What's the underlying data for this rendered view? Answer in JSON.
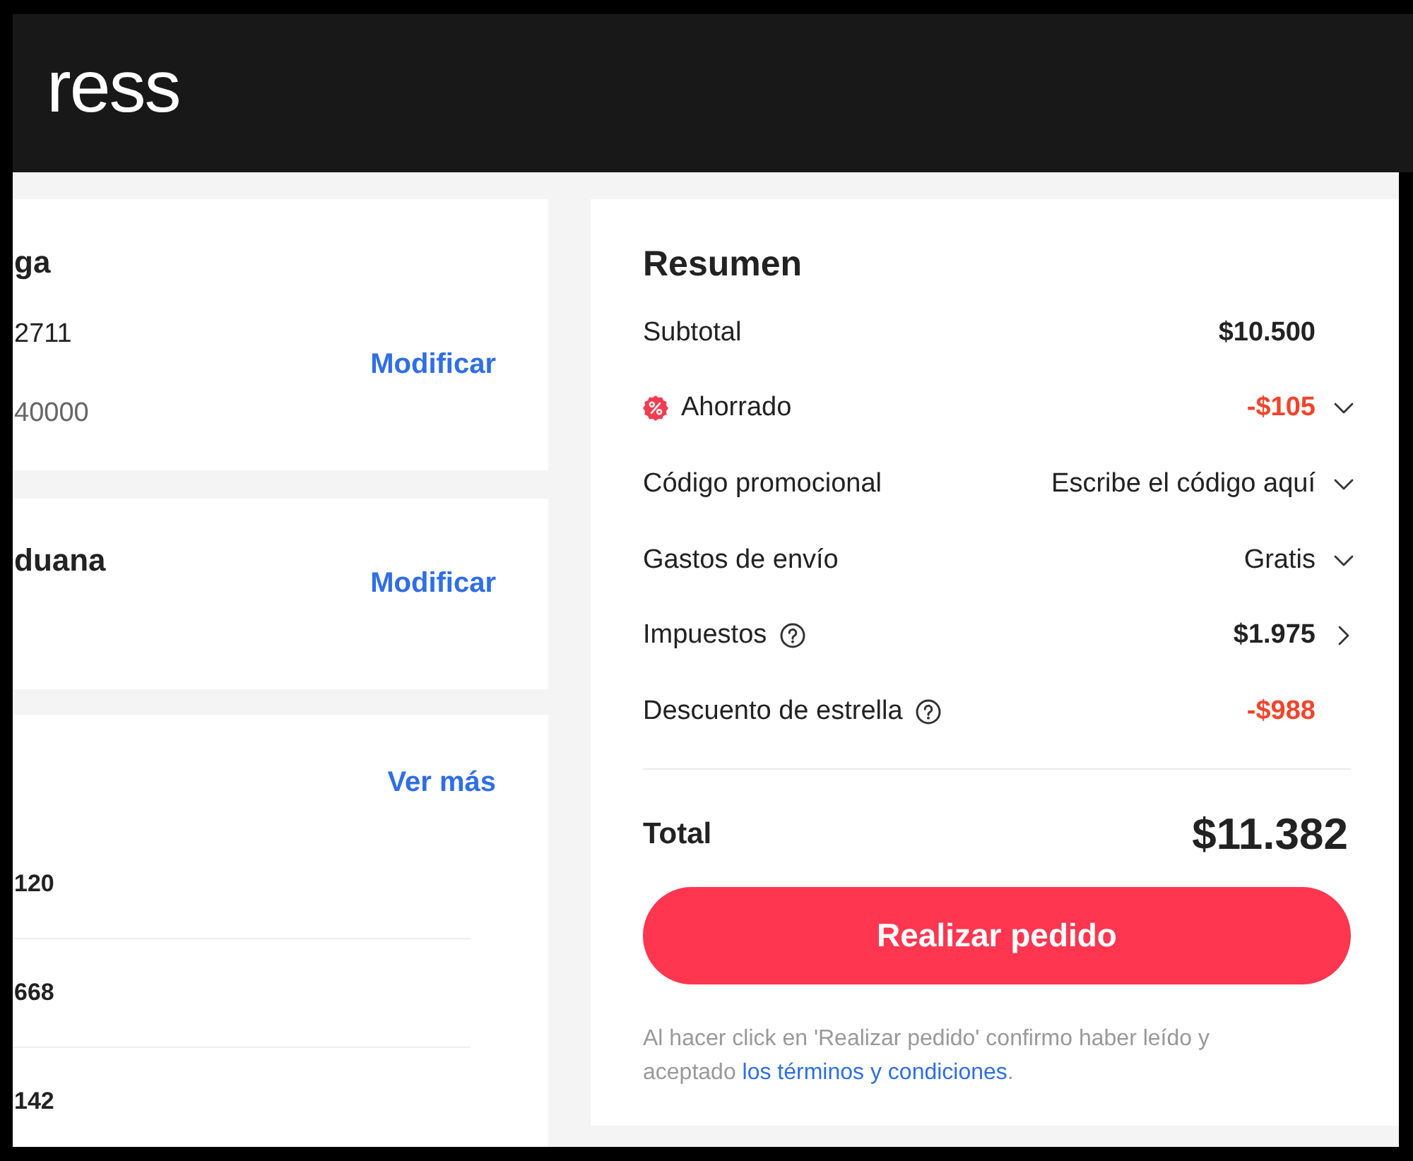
{
  "header": {
    "logo_text": "ress"
  },
  "left_cards": [
    {
      "kind": "address",
      "title": "ga",
      "lines": [
        {
          "text": "2711",
          "muted": false
        },
        {
          "text": "40000",
          "muted": true
        }
      ],
      "action": "Modificar"
    },
    {
      "kind": "customs",
      "title": "duana",
      "action": "Modificar"
    },
    {
      "kind": "items",
      "action": "Ver más",
      "rows": [
        "120",
        "668",
        "142"
      ]
    }
  ],
  "summary": {
    "title": "Resumen",
    "rows": [
      {
        "kind": "subtotal",
        "label": "Subtotal",
        "value": "$10.500"
      },
      {
        "kind": "savings",
        "label": "Ahorrado",
        "value": "-$105"
      },
      {
        "kind": "promo",
        "label": "Código promocional",
        "value": "Escribe el código aquí"
      },
      {
        "kind": "shipping",
        "label": "Gastos de envío",
        "value": "Gratis"
      },
      {
        "kind": "taxes",
        "label": "Impuestos",
        "value": "$1.975"
      },
      {
        "kind": "star",
        "label": "Descuento de estrella",
        "value": "-$988"
      }
    ],
    "total": {
      "label": "Total",
      "value": "$11.382"
    },
    "button": "Realizar pedido",
    "terms": {
      "text": "Al hacer click en 'Realizar pedido' confirmo haber leído y aceptado ",
      "link": "los términos y condiciones",
      "after": "."
    }
  }
}
